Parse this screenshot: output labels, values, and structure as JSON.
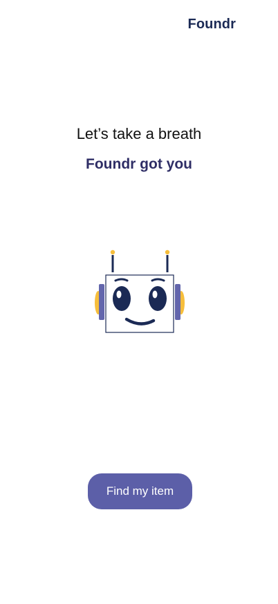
{
  "header": {
    "brand": "Foundr"
  },
  "main": {
    "headline": "Let’s take a breath",
    "subheadline": "Foundr got you",
    "mascot_icon": "robot-mascot-icon",
    "cta_label": "Find my item"
  },
  "colors": {
    "brand": "#1b2a55",
    "subheadline": "#2f2e66",
    "button": "#5c5fa8",
    "robot_accent": "#f6be3c",
    "robot_ear": "#6366ac"
  }
}
